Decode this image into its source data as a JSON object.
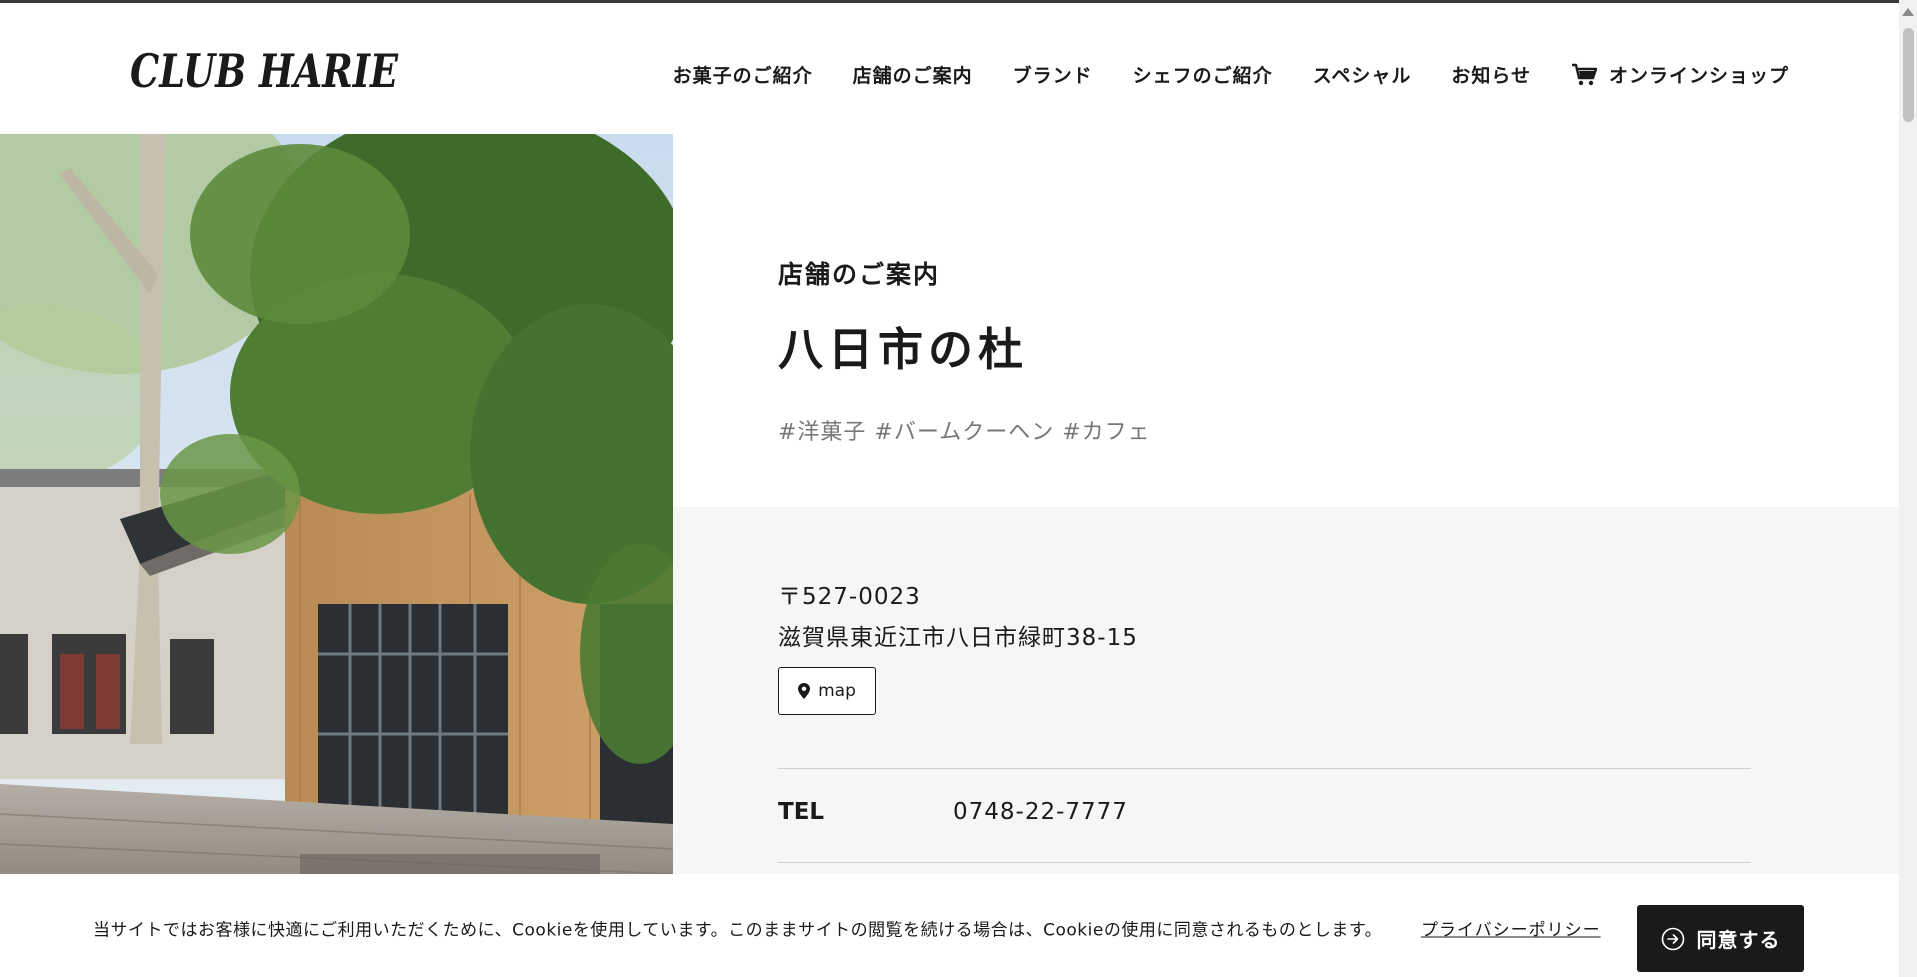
{
  "header": {
    "logo_text": "CLUB HARIE",
    "nav": [
      {
        "label": "お菓子のご紹介"
      },
      {
        "label": "店舗のご案内"
      },
      {
        "label": "ブランド"
      },
      {
        "label": "シェフのご紹介"
      },
      {
        "label": "スペシャル"
      },
      {
        "label": "お知らせ"
      },
      {
        "label": "オンラインショップ",
        "icon": "cart-icon"
      }
    ]
  },
  "main": {
    "section_label": "店舗のご案内",
    "store_name": "八日市の杜",
    "tags": "#洋菓子 #バームクーヘン #カフェ",
    "info": {
      "postal": "〒527-0023",
      "address": "滋賀県東近江市八日市緑町38-15",
      "map_label": "map",
      "map_icon": "map-pin-icon",
      "tel_label": "TEL",
      "tel_value": "0748-22-7777"
    }
  },
  "cookie": {
    "text": "当サイトではお客様に快適にご利用いただくために、Cookieを使用しています。このままサイトの閲覧を続ける場合は、Cookieの使用に同意されるものとします。",
    "privacy_label": "プライバシーポリシー",
    "agree_label": "同意する",
    "agree_icon": "arrow-circle-icon"
  },
  "colors": {
    "text": "#1a1a1a",
    "tag_gray": "#777777",
    "panel_bg": "#f6f6f6",
    "button_dark": "#1a1a1a"
  }
}
